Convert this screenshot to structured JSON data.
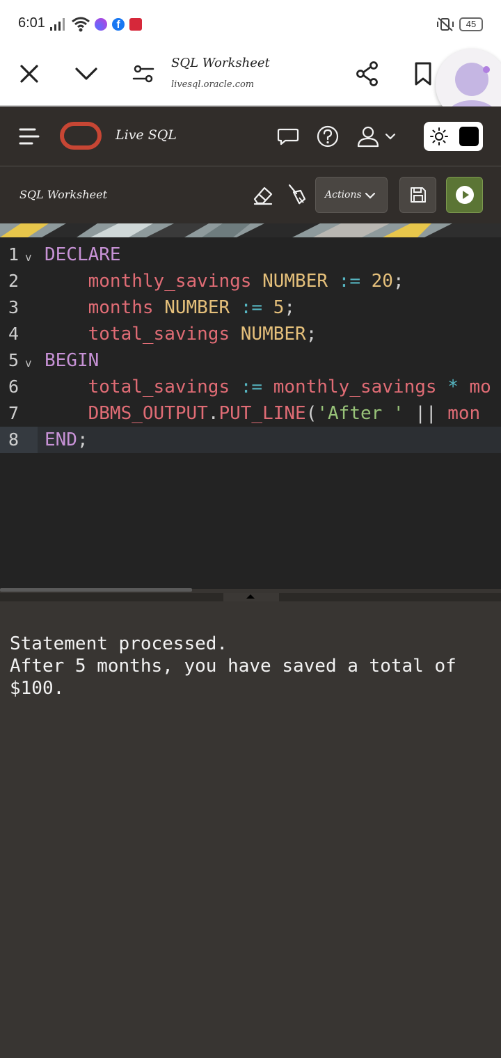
{
  "status_bar": {
    "time": "6:01",
    "battery": "45"
  },
  "browser": {
    "page_title": "SQL Worksheet",
    "url": "livesql.oracle.com"
  },
  "app": {
    "title": "Live SQL",
    "accent_color": "#c74634"
  },
  "worksheet": {
    "title": "SQL Worksheet",
    "actions_label": "Actions"
  },
  "editor": {
    "line_numbers": [
      "1",
      "2",
      "3",
      "4",
      "5",
      "6",
      "7",
      "8"
    ],
    "active_line": 8,
    "code": {
      "l1_kw": "DECLARE",
      "l2_id": "monthly_savings",
      "l2_ty": "NUMBER",
      "l2_op": ":=",
      "l2_num": "20",
      "l2_end": ";",
      "l3_id": "months",
      "l3_ty": "NUMBER",
      "l3_op": ":=",
      "l3_num": "5",
      "l3_end": ";",
      "l4_id": "total_savings",
      "l4_ty": "NUMBER",
      "l4_end": ";",
      "l5_kw": "BEGIN",
      "l6_id": "total_savings",
      "l6_op": ":=",
      "l6_id2": "monthly_savings",
      "l6_op2": "*",
      "l6_id3": "mo",
      "l7_a": "DBMS_OUTPUT",
      "l7_dot": ".",
      "l7_b": "PUT_LINE",
      "l7_paren": "(",
      "l7_str": "'After '",
      "l7_op": "||",
      "l7_c": "mon",
      "l8_kw": "END",
      "l8_end": ";"
    }
  },
  "output": {
    "lines": [
      "Statement processed.",
      "After 5 months, you have saved a total of",
      "$100."
    ]
  }
}
